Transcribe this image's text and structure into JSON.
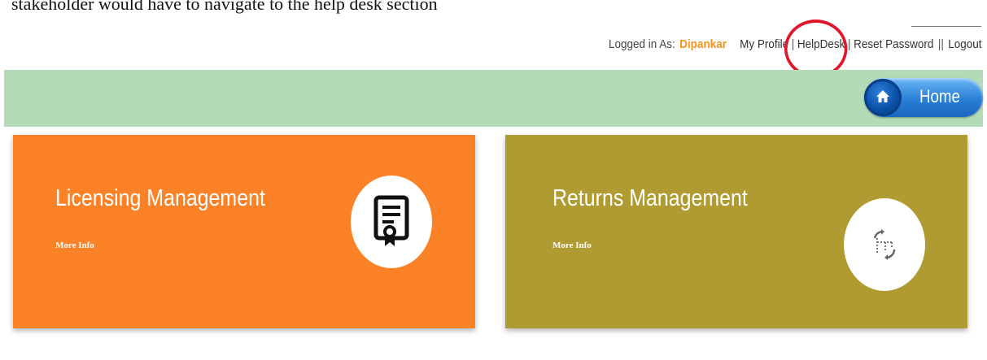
{
  "caption": "stakeholder would have to navigate to the help desk section",
  "topbar": {
    "logged_in_label": "Logged in As:",
    "user_name": "Dipankar",
    "my_profile": "My Profile",
    "helpdesk": "HelpDesk",
    "reset_password": "Reset Password",
    "logout": "Logout",
    "separator": "|",
    "double_separator": "||"
  },
  "nav": {
    "home_label": "Home",
    "home_icon": "home-icon"
  },
  "cards": [
    {
      "title": "Licensing Management",
      "more_info": "More Info",
      "icon": "certificate-icon",
      "color": "#fb8226"
    },
    {
      "title": "Returns Management",
      "more_info": "More Info",
      "icon": "returns-flow-icon",
      "color": "#b09b33"
    }
  ],
  "colors": {
    "accent_user": "#f7931e",
    "header_bar": "#b4dbb7",
    "home_button": "#2a7fd6",
    "annotation": "#e0162b"
  }
}
